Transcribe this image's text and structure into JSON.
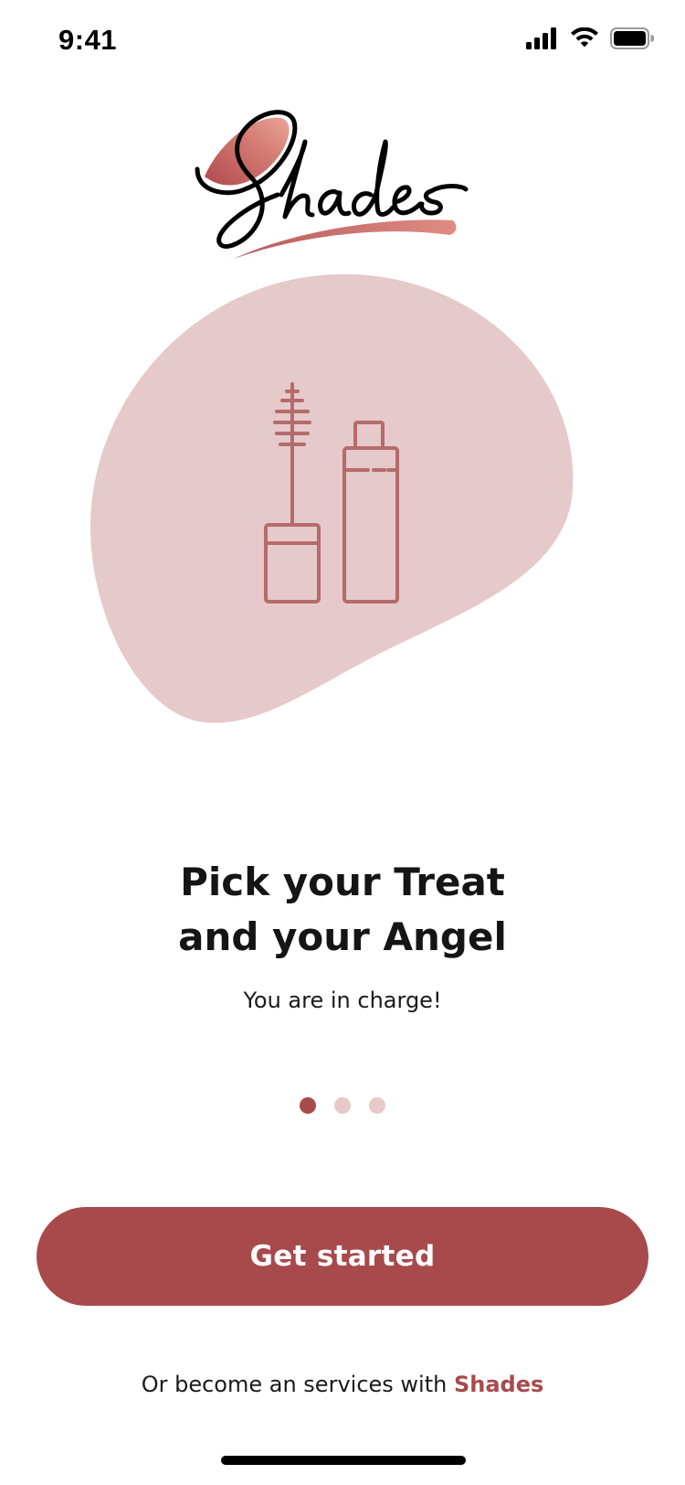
{
  "status_bar": {
    "time": "9:41",
    "icons": [
      "cellular-signal-icon",
      "wifi-icon",
      "battery-icon"
    ]
  },
  "brand": {
    "logo_text": "Shades",
    "accent_color": "#a84a4c",
    "soft_color": "#e6c9ca"
  },
  "hero": {
    "icons": [
      "mascara-icon",
      "cosmetic-bottle-icon"
    ]
  },
  "onboarding": {
    "title_line1": "Pick your Treat",
    "title_line2": "and your Angel",
    "subtitle": "You are in charge!",
    "pages_total": 3,
    "current_page": 1
  },
  "cta": {
    "label": "Get started"
  },
  "footer": {
    "prefix": "Or become an services with ",
    "link_label": "Shades"
  }
}
